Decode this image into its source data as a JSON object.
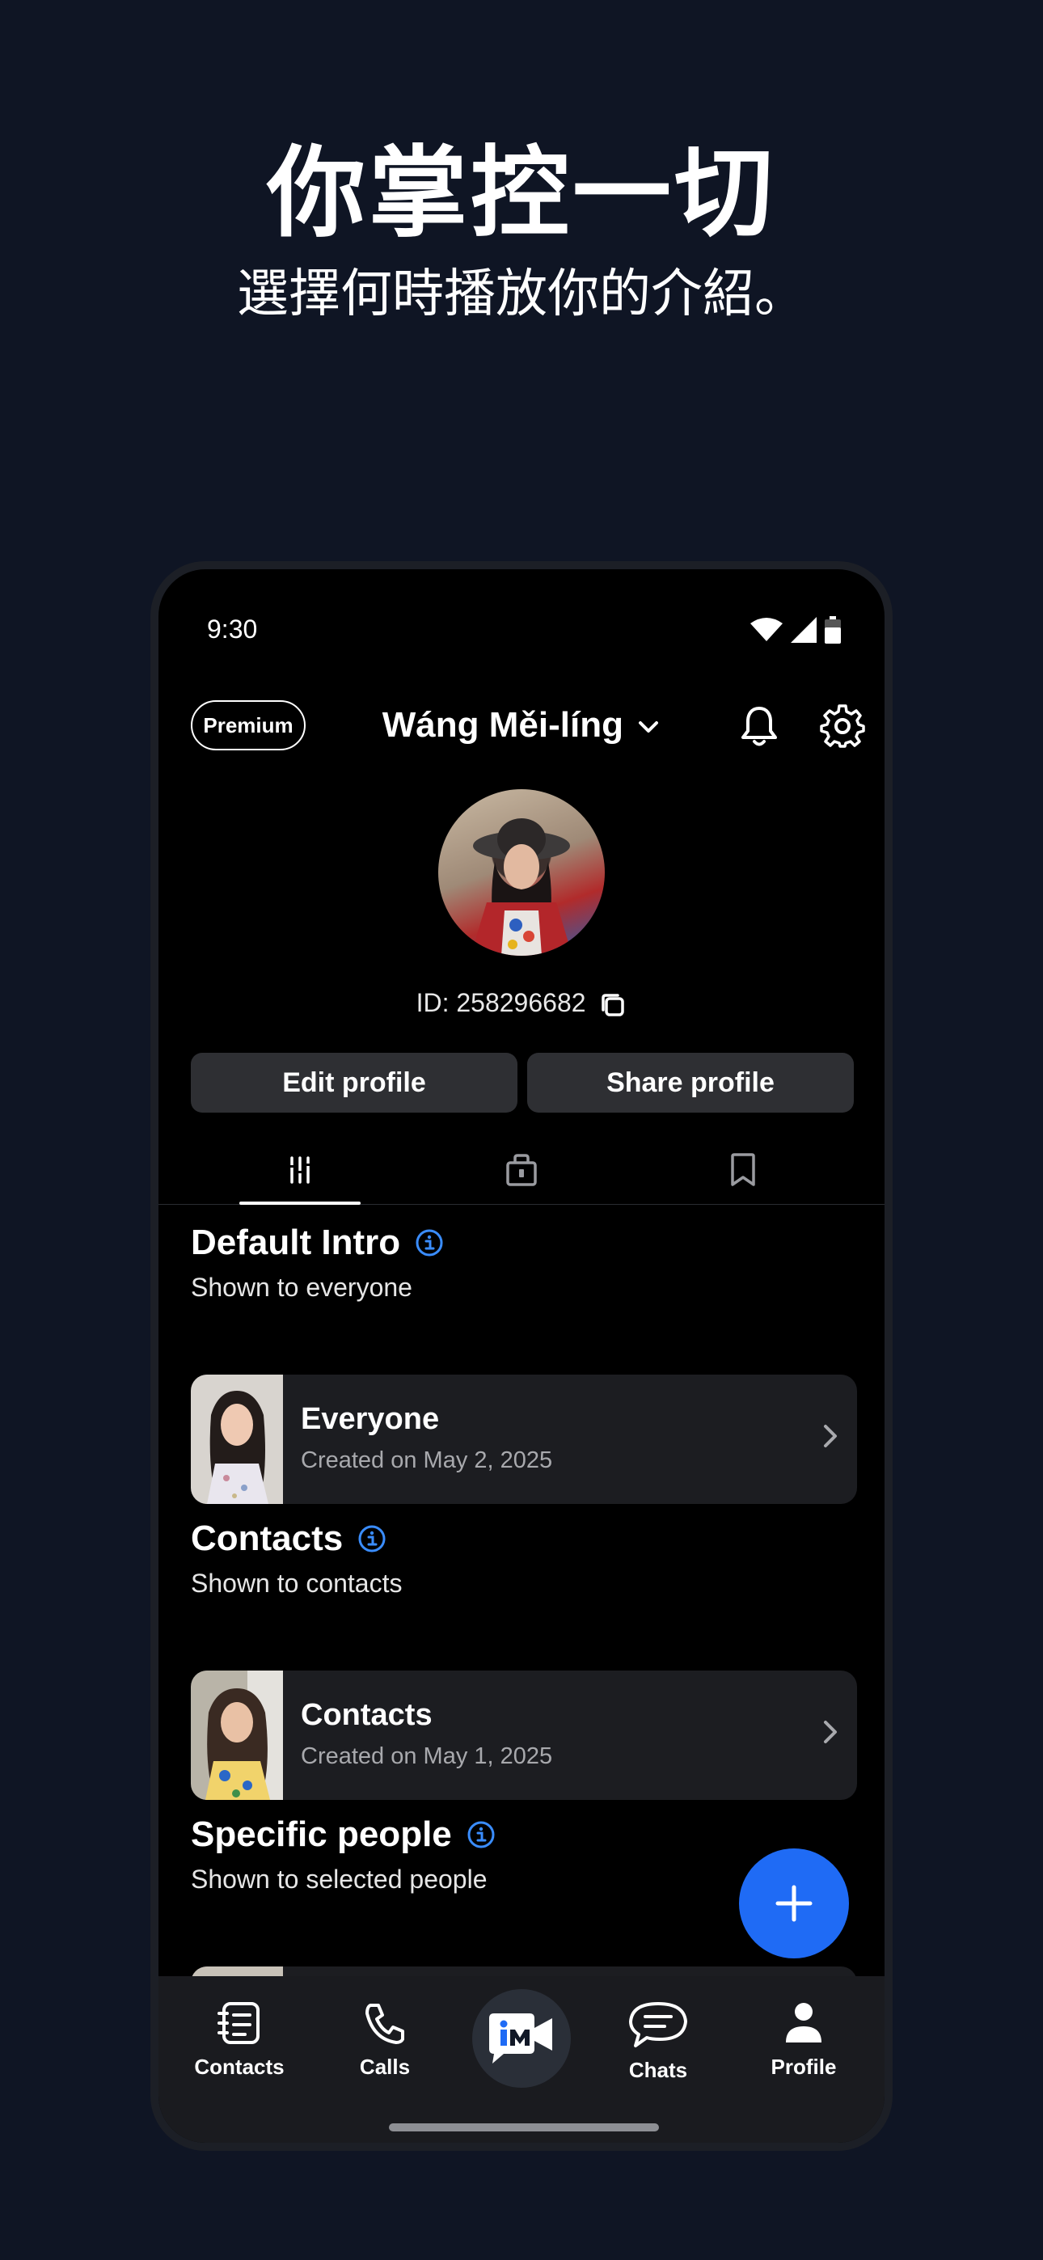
{
  "promo": {
    "headline": "你掌控一切",
    "subline": "選擇何時播放你的介紹。"
  },
  "status": {
    "time": "9:30"
  },
  "header": {
    "badge": "Premium",
    "name": "Wáng Měi-líng"
  },
  "profile": {
    "id_text": "ID: 258296682",
    "edit_label": "Edit profile",
    "share_label": "Share profile"
  },
  "sections": [
    {
      "title": "Default Intro",
      "subtitle": "Shown to everyone",
      "card": {
        "title": "Everyone",
        "date": "Created on May 2, 2025"
      }
    },
    {
      "title": "Contacts",
      "subtitle": "Shown to contacts",
      "card": {
        "title": "Contacts",
        "date": "Created on May 1, 2025"
      }
    },
    {
      "title": "Specific people",
      "subtitle": "Shown to selected people"
    }
  ],
  "nav": {
    "contacts": "Contacts",
    "calls": "Calls",
    "chats": "Chats",
    "profile": "Profile"
  },
  "colors": {
    "page_bg": "#0f1524",
    "accent": "#1f6bf5",
    "info_icon": "#3a8dff"
  }
}
